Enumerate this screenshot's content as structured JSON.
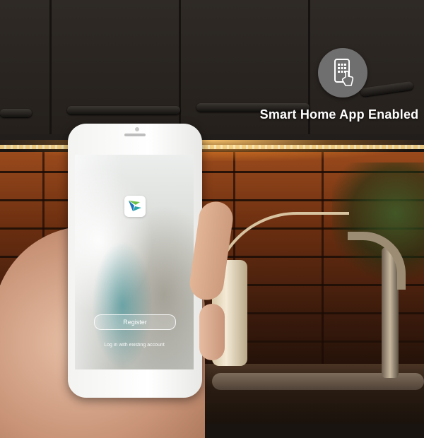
{
  "badge": {
    "icon": "smartphone-touch-icon",
    "text": "Smart Home App Enabled"
  },
  "phone_app": {
    "logo_icon": "app-logo-icon",
    "register_label": "Register",
    "login_label": "Log in with existing account"
  },
  "colors": {
    "badge_bg": "#6f6f6f",
    "led_glow": "#ffd98a",
    "logo_blue": "#1e73be",
    "logo_green": "#6cc04a"
  }
}
